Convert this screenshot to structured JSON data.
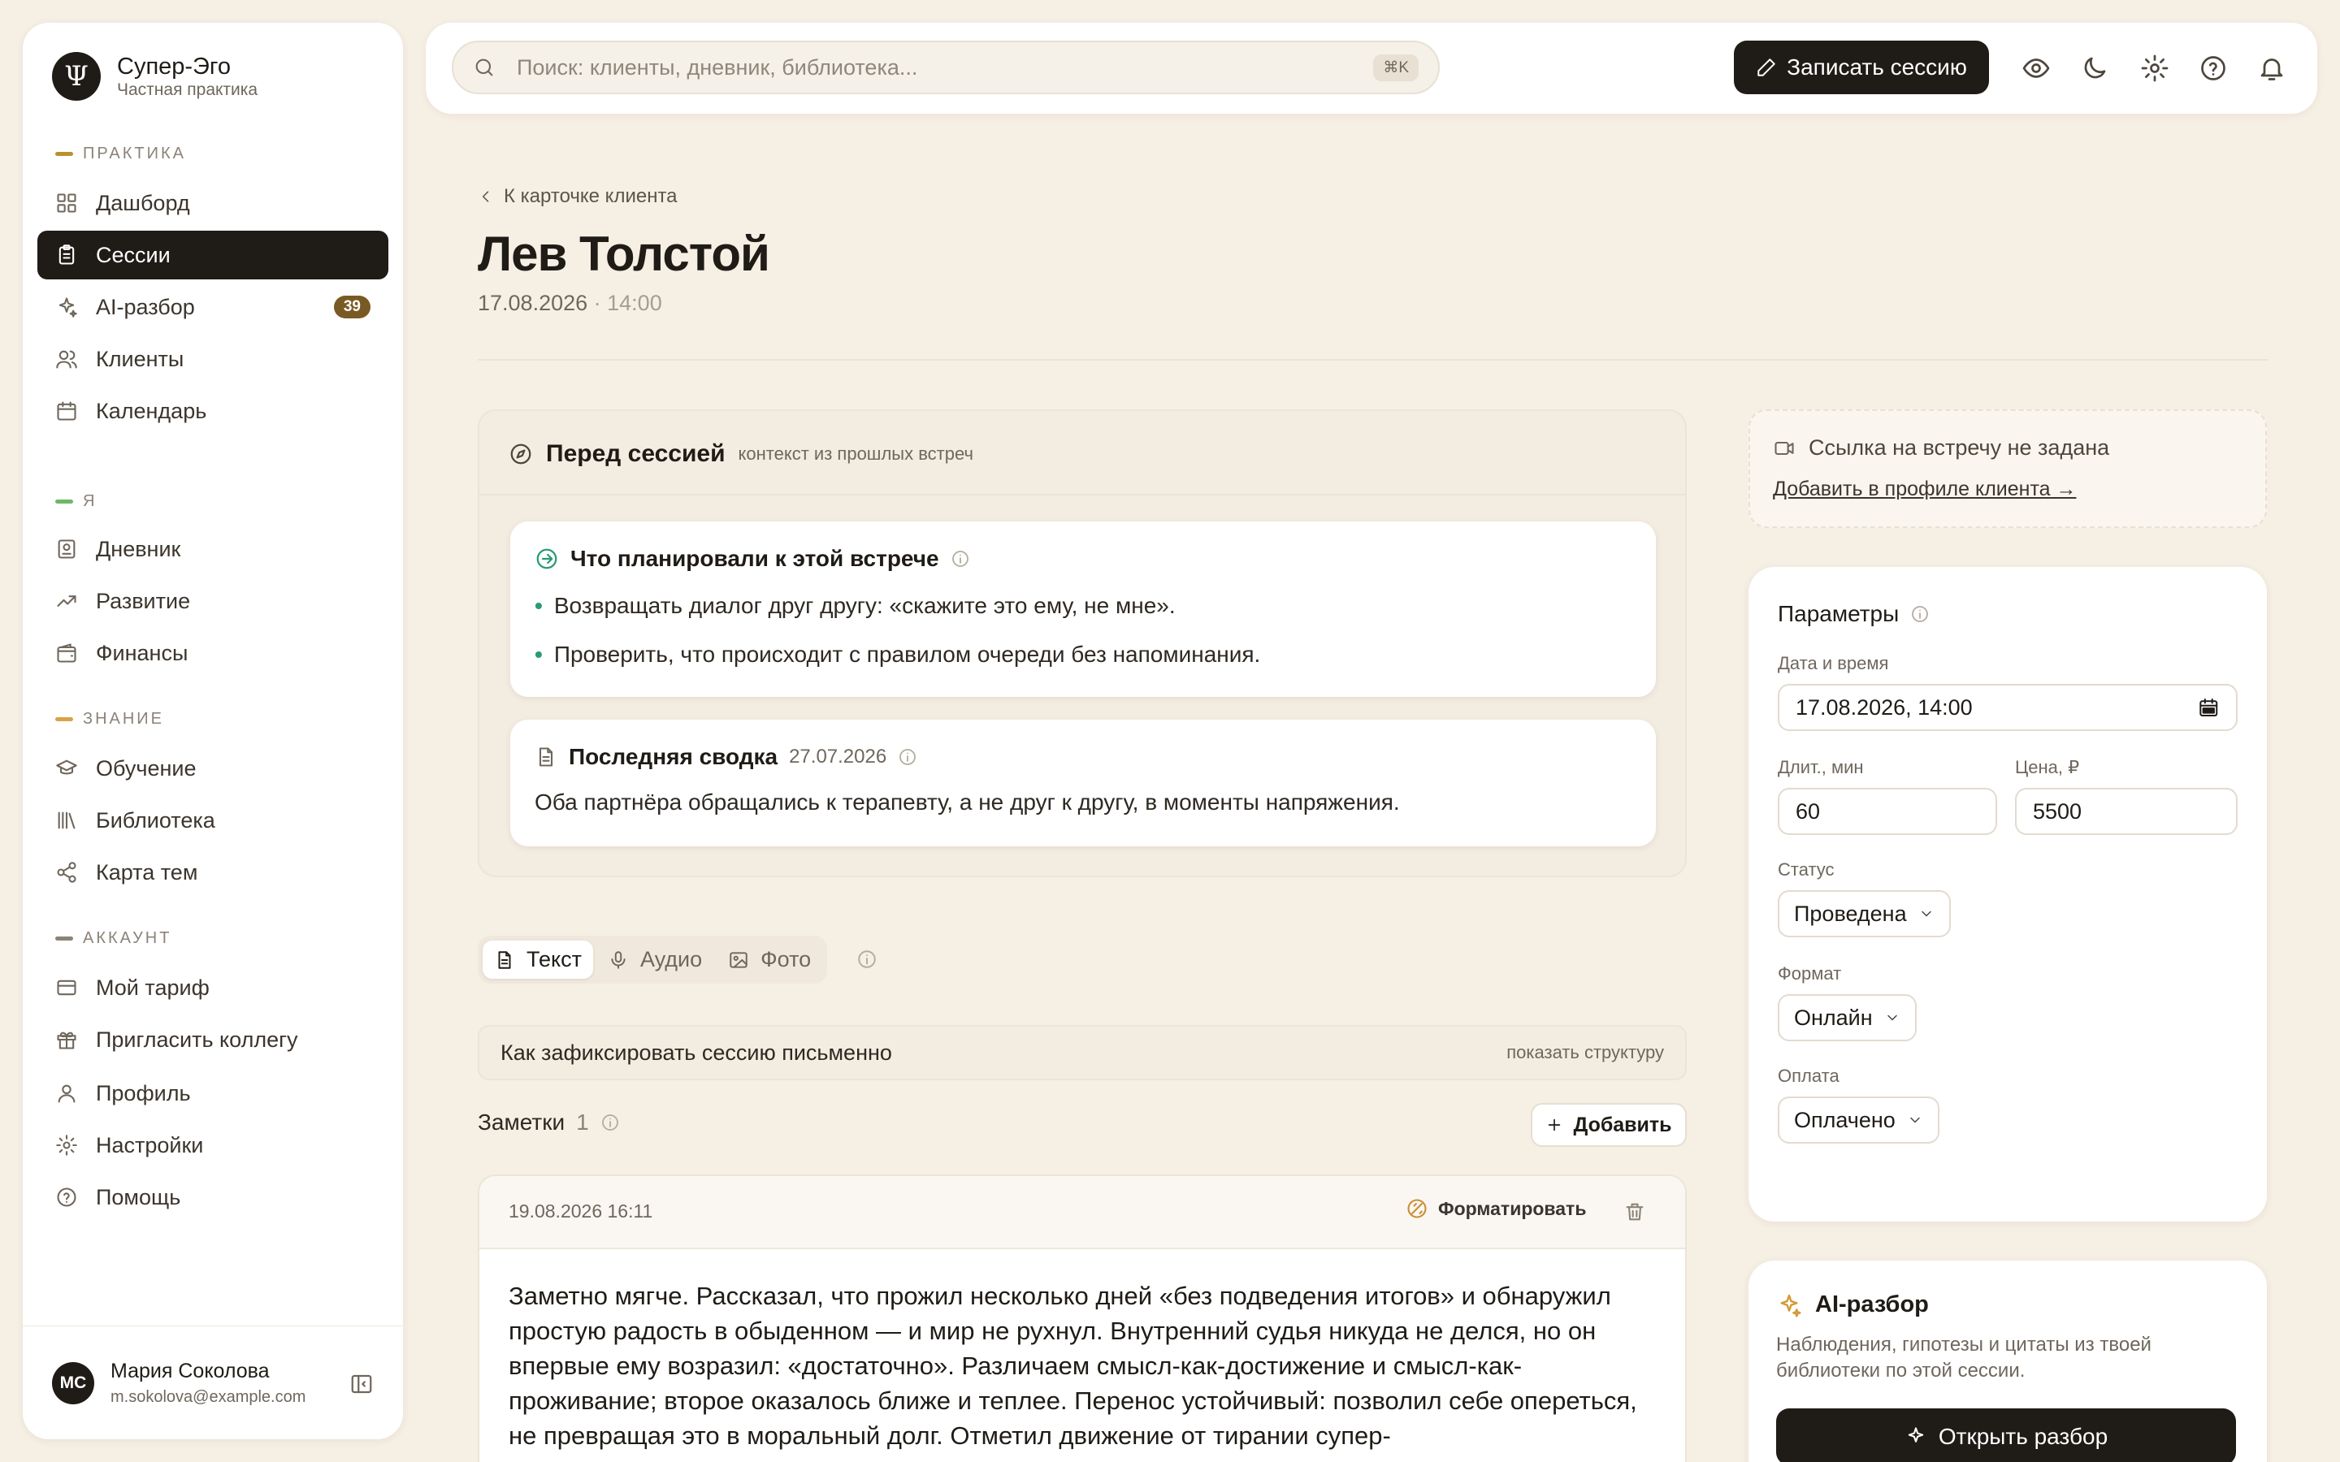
{
  "brand": {
    "name": "Супер-Эго",
    "subtitle": "Частная практика",
    "logo": "Ψ"
  },
  "sidebar": {
    "sections": [
      {
        "label": "ПРАКТИКА",
        "color": "#b8922e"
      },
      {
        "label": "Я",
        "color": "#6cb86a"
      },
      {
        "label": "ЗНАНИЕ",
        "color": "#d9a24a"
      },
      {
        "label": "АККАУНТ",
        "color": "#8b8377"
      }
    ],
    "items": [
      {
        "label": "Дашборд",
        "icon": "dashboard-icon"
      },
      {
        "label": "Сессии",
        "icon": "clipboard-icon",
        "active": true
      },
      {
        "label": "AI-разбор",
        "icon": "sparkles-icon",
        "badge": "39"
      },
      {
        "label": "Клиенты",
        "icon": "users-icon"
      },
      {
        "label": "Календарь",
        "icon": "calendar-icon"
      },
      {
        "label": "Дневник",
        "icon": "journal-icon"
      },
      {
        "label": "Развитие",
        "icon": "trending-up-icon"
      },
      {
        "label": "Финансы",
        "icon": "wallet-icon"
      },
      {
        "label": "Обучение",
        "icon": "graduation-cap-icon"
      },
      {
        "label": "Библиотека",
        "icon": "library-icon"
      },
      {
        "label": "Карта тем",
        "icon": "share-graph-icon"
      },
      {
        "label": "Мой тариф",
        "icon": "credit-card-icon"
      },
      {
        "label": "Пригласить коллегу",
        "icon": "gift-icon"
      },
      {
        "label": "Профиль",
        "icon": "user-icon"
      },
      {
        "label": "Настройки",
        "icon": "gear-icon"
      },
      {
        "label": "Помощь",
        "icon": "help-circle-icon"
      }
    ],
    "user": {
      "initials": "МС",
      "name": "Мария Соколова",
      "email": "m.sokolova@example.com"
    }
  },
  "topbar": {
    "search_placeholder": "Поиск: клиенты, дневник, библиотека...",
    "shortcut": "⌘K",
    "record_label": "Записать сессию"
  },
  "header": {
    "back_label": "К карточке клиента",
    "client_name": "Лев Толстой",
    "date": "17.08.2026",
    "separator": " · ",
    "time": "14:00"
  },
  "pre_session": {
    "title": "Перед сессией",
    "subtitle": "контекст из прошлых встреч",
    "plan_title": "Что планировали к этой встрече",
    "plan_items": [
      "Возвращать диалог друг другу: «скажите это ему, не мне».",
      "Проверить, что происходит с правилом очереди без напоминания."
    ],
    "summary_title": "Последняя сводка",
    "summary_date": "27.07.2026",
    "summary_text": "Оба партнёра обращались к терапевту, а не друг к другу, в моменты напряжения."
  },
  "tabs": [
    {
      "label": "Текст",
      "icon": "file-text-icon",
      "active": true
    },
    {
      "label": "Аудио",
      "icon": "microphone-icon"
    },
    {
      "label": "Фото",
      "icon": "image-icon"
    }
  ],
  "hint": {
    "text": "Как зафиксировать сессию письменно",
    "action": "показать структуру"
  },
  "notes": {
    "title": "Заметки",
    "count": "1",
    "add_label": "Добавить",
    "items": [
      {
        "timestamp": "19.08.2026 16:11",
        "format_label": "Форматировать",
        "text": "Заметно мягче. Рассказал, что прожил несколько дней «без подведения итогов» и обнаружил простую радость в обыденном — и мир не рухнул. Внутренний судья никуда не делся, но он впервые ему возразил: «достаточно». Различаем смысл-как-достижение и смысл-как-проживание; второе оказалось ближе и теплее. Перенос устойчивый: позволил себе опереться, не превращая это в моральный долг. Отметил движение от тирании супер-"
      }
    ]
  },
  "meeting": {
    "text": "Ссылка на встречу не задана",
    "link": "Добавить в профиле клиента →"
  },
  "params": {
    "title": "Параметры",
    "datetime_label": "Дата и время",
    "datetime_value": "17.08.2026, 14:00",
    "duration_label": "Длит., мин",
    "duration_value": "60",
    "price_label": "Цена, ₽",
    "price_value": "5500",
    "status_label": "Статус",
    "status_value": "Проведена",
    "format_label": "Формат",
    "format_value": "Онлайн",
    "payment_label": "Оплата",
    "payment_value": "Оплачено"
  },
  "ai": {
    "title": "AI-разбор",
    "description": "Наблюдения, гипотезы и цитаты из твоей библиотеки по этой сессии.",
    "button": "Открыть разбор"
  }
}
